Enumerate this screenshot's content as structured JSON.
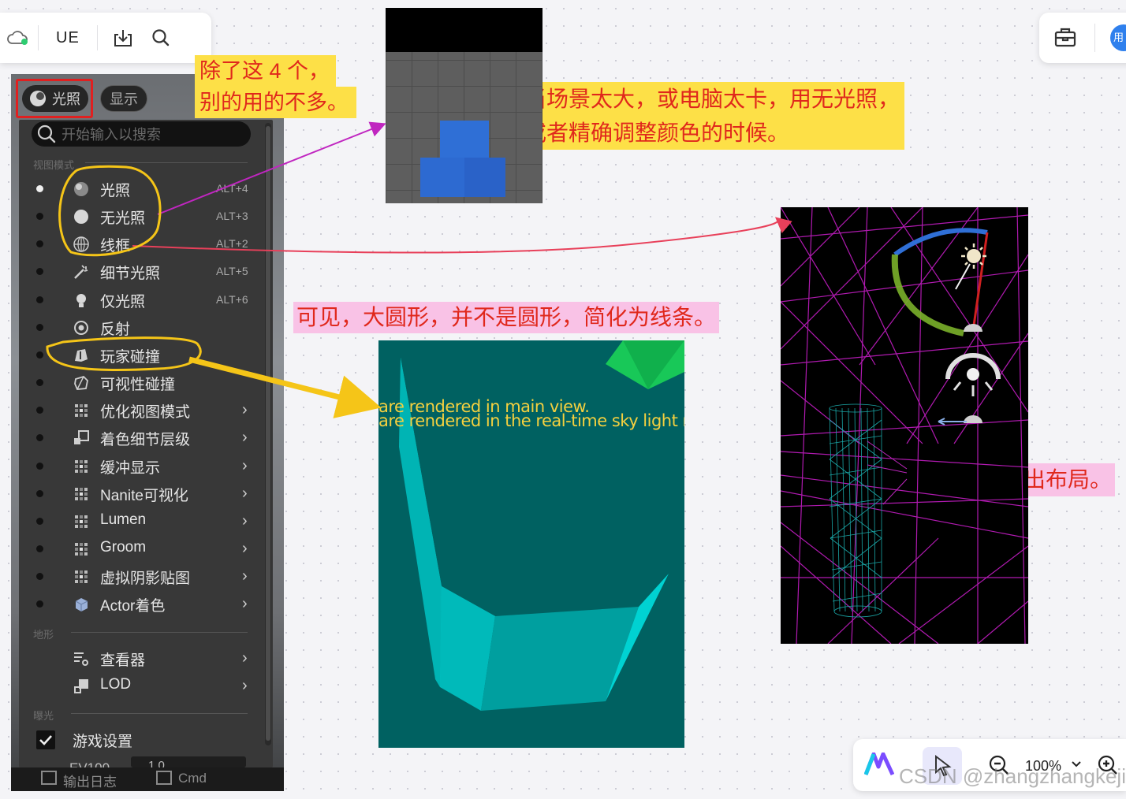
{
  "toolbar": {
    "title": "UE",
    "icons": [
      "cloud-sync-icon",
      "download-icon",
      "search-icon"
    ]
  },
  "top_right": {
    "icons": [
      "toolbox-icon"
    ],
    "avatar_text": "用"
  },
  "ue_menu": {
    "tab_lighting": "光照",
    "tab_show": "显示",
    "search_placeholder": "开始输入以搜索",
    "section_view_mode": "视图模式",
    "section_terrain": "地形",
    "section_exposure": "曝光",
    "items": [
      {
        "label": "光照",
        "shortcut": "ALT+4",
        "selected": true,
        "submenu": false,
        "icon": "lit-sphere-icon"
      },
      {
        "label": "无光照",
        "shortcut": "ALT+3",
        "selected": false,
        "submenu": false,
        "icon": "unlit-sphere-icon"
      },
      {
        "label": "线框",
        "shortcut": "ALT+2",
        "selected": false,
        "submenu": false,
        "icon": "wireframe-sphere-icon"
      },
      {
        "label": "细节光照",
        "shortcut": "ALT+5",
        "selected": false,
        "submenu": false,
        "icon": "detail-lighting-icon"
      },
      {
        "label": "仅光照",
        "shortcut": "ALT+6",
        "selected": false,
        "submenu": false,
        "icon": "bulb-icon"
      },
      {
        "label": "反射",
        "shortcut": "",
        "selected": false,
        "submenu": false,
        "icon": "reflection-icon"
      },
      {
        "label": "玩家碰撞",
        "shortcut": "",
        "selected": false,
        "submenu": false,
        "icon": "player-collision-icon"
      },
      {
        "label": "可视性碰撞",
        "shortcut": "",
        "selected": false,
        "submenu": false,
        "icon": "visibility-collision-icon"
      },
      {
        "label": "优化视图模式",
        "shortcut": "",
        "selected": false,
        "submenu": true,
        "icon": "grid-icon"
      },
      {
        "label": "着色细节层级",
        "shortcut": "",
        "selected": false,
        "submenu": true,
        "icon": "shading-lod-icon"
      },
      {
        "label": "缓冲显示",
        "shortcut": "",
        "selected": false,
        "submenu": true,
        "icon": "grid-icon"
      },
      {
        "label": "Nanite可视化",
        "shortcut": "",
        "selected": false,
        "submenu": true,
        "icon": "grid-icon"
      },
      {
        "label": "Lumen",
        "shortcut": "",
        "selected": false,
        "submenu": true,
        "icon": "grid-icon"
      },
      {
        "label": "Groom",
        "shortcut": "",
        "selected": false,
        "submenu": true,
        "icon": "grid-icon"
      },
      {
        "label": "虚拟阴影贴图",
        "shortcut": "",
        "selected": false,
        "submenu": true,
        "icon": "grid-icon"
      },
      {
        "label": "Actor着色",
        "shortcut": "",
        "selected": false,
        "submenu": true,
        "icon": "cube-icon"
      }
    ],
    "terrain_items": [
      {
        "label": "查看器",
        "submenu": true,
        "icon": "viewer-icon"
      },
      {
        "label": "LOD",
        "submenu": true,
        "icon": "lod-icon"
      }
    ],
    "exposure_item": {
      "label": "游戏设置",
      "checked": true
    },
    "partial_row": "EV100",
    "partial_value": "1.0",
    "bottom_bar": {
      "left": "输出日志",
      "right": "Cmd"
    }
  },
  "notes": {
    "note_top": [
      "除了这 4 个，",
      "别的用的不多。"
    ],
    "note_unlit": [
      "当场景太大，或电脑太卡，用无光照，",
      "或者精确调整颜色的时候。"
    ],
    "note_collision": "可见，大圆形，并不是圆形，简化为线条。",
    "note_wireframe": "通过线框看出布局。"
  },
  "collision_image": {
    "line1": "are rendered in main view.",
    "line2": "are rendered in the real-time sky light reflec"
  },
  "bottom_toolbar": {
    "zoom": "100%",
    "icons": [
      "app-logo-icon",
      "pointer-icon",
      "zoom-out-icon",
      "chevron-down-icon",
      "zoom-in-icon"
    ]
  },
  "watermark": "CSDN @zhangzhangkeji",
  "colors": {
    "annotation_red": "#e0281c",
    "highlight_yellow": "#fde047",
    "highlight_pink": "#f9c2e6",
    "circle_yellow": "#f5c518",
    "arrow_magenta": "#c026c0",
    "arrow_red": "#e8405a"
  }
}
